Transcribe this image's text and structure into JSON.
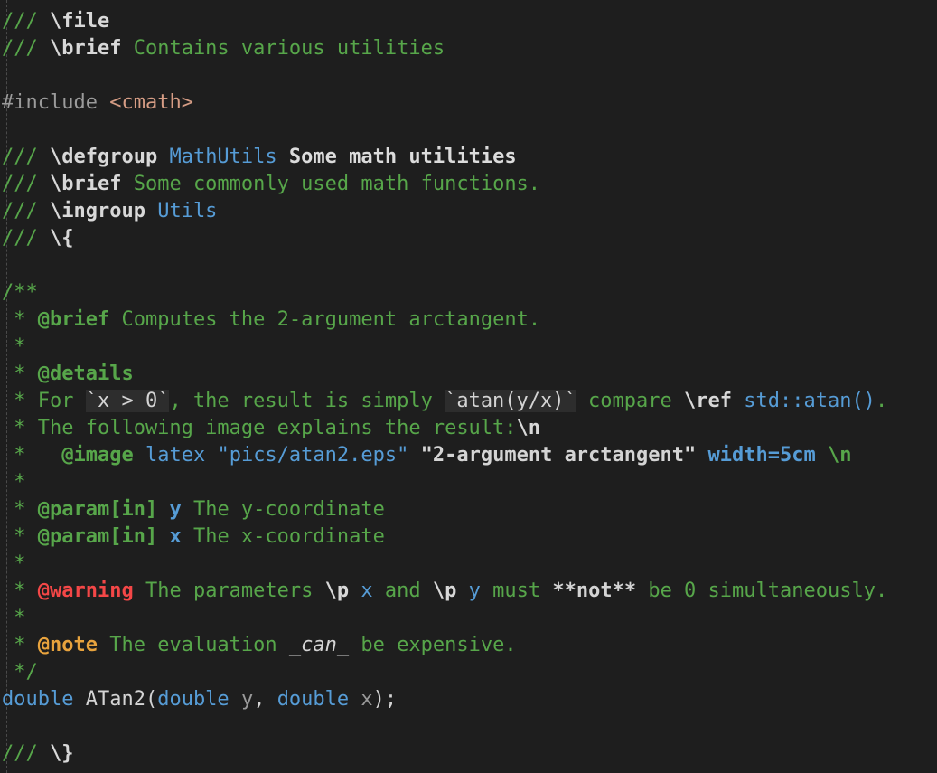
{
  "lines": [
    [
      {
        "t": "/// ",
        "c": "comment"
      },
      {
        "t": "\\file",
        "c": "tag-white"
      }
    ],
    [
      {
        "t": "/// ",
        "c": "comment"
      },
      {
        "t": "\\brief",
        "c": "tag-white"
      },
      {
        "t": " Contains various utilities",
        "c": "comment"
      }
    ],
    [],
    [
      {
        "t": "#include ",
        "c": "include"
      },
      {
        "t": "<cmath>",
        "c": "header"
      }
    ],
    [],
    [
      {
        "t": "/// ",
        "c": "comment"
      },
      {
        "t": "\\defgroup",
        "c": "tag-white"
      },
      {
        "t": " ",
        "c": "comment"
      },
      {
        "t": "MathUtils",
        "c": "name"
      },
      {
        "t": " Some math utilities",
        "c": "title"
      }
    ],
    [
      {
        "t": "/// ",
        "c": "comment"
      },
      {
        "t": "\\brief",
        "c": "tag-white"
      },
      {
        "t": " Some commonly used math functions.",
        "c": "comment"
      }
    ],
    [
      {
        "t": "/// ",
        "c": "comment"
      },
      {
        "t": "\\ingroup",
        "c": "tag-white"
      },
      {
        "t": " ",
        "c": "comment"
      },
      {
        "t": "Utils",
        "c": "name"
      }
    ],
    [
      {
        "t": "/// ",
        "c": "comment"
      },
      {
        "t": "\\{",
        "c": "tag-white"
      }
    ],
    [],
    [
      {
        "t": "/**",
        "c": "comment"
      }
    ],
    [
      {
        "t": " * ",
        "c": "comment"
      },
      {
        "t": "@brief",
        "c": "tag"
      },
      {
        "t": " Computes the 2-argument arctangent.",
        "c": "comment"
      }
    ],
    [
      {
        "t": " *",
        "c": "comment"
      }
    ],
    [
      {
        "t": " * ",
        "c": "comment"
      },
      {
        "t": "@details",
        "c": "tag"
      }
    ],
    [
      {
        "t": " * For ",
        "c": "comment"
      },
      {
        "t": "`x > 0`",
        "c": "code"
      },
      {
        "t": ", the result is simply ",
        "c": "comment"
      },
      {
        "t": "`atan(y/x)`",
        "c": "code"
      },
      {
        "t": " compare ",
        "c": "comment"
      },
      {
        "t": "\\ref",
        "c": "tag-white"
      },
      {
        "t": " ",
        "c": "comment"
      },
      {
        "t": "std::atan()",
        "c": "name"
      },
      {
        "t": ".",
        "c": "comment"
      }
    ],
    [
      {
        "t": " * The following image explains the result:",
        "c": "comment"
      },
      {
        "t": "\\n",
        "c": "tag-white"
      }
    ],
    [
      {
        "t": " *   ",
        "c": "comment"
      },
      {
        "t": "@image",
        "c": "tag"
      },
      {
        "t": " ",
        "c": "comment"
      },
      {
        "t": "latex",
        "c": "name"
      },
      {
        "t": " ",
        "c": "comment"
      },
      {
        "t": "\"pics/atan2.eps\"",
        "c": "name"
      },
      {
        "t": " ",
        "c": "comment"
      },
      {
        "t": "\"2-argument arctangent\"",
        "c": "quoted"
      },
      {
        "t": " ",
        "c": "comment"
      },
      {
        "t": "width=5cm",
        "c": "name-bold"
      },
      {
        "t": " ",
        "c": "comment"
      },
      {
        "t": "\\n",
        "c": "tag"
      }
    ],
    [
      {
        "t": " *",
        "c": "comment"
      }
    ],
    [
      {
        "t": " * ",
        "c": "comment"
      },
      {
        "t": "@param[in]",
        "c": "tag"
      },
      {
        "t": " ",
        "c": "comment"
      },
      {
        "t": "y",
        "c": "name-bold"
      },
      {
        "t": " The y-coordinate",
        "c": "comment"
      }
    ],
    [
      {
        "t": " * ",
        "c": "comment"
      },
      {
        "t": "@param[in]",
        "c": "tag"
      },
      {
        "t": " ",
        "c": "comment"
      },
      {
        "t": "x",
        "c": "name-bold"
      },
      {
        "t": " The x-coordinate",
        "c": "comment"
      }
    ],
    [
      {
        "t": " *",
        "c": "comment"
      }
    ],
    [
      {
        "t": " * ",
        "c": "comment"
      },
      {
        "t": "@warning",
        "c": "warning"
      },
      {
        "t": " The parameters ",
        "c": "comment"
      },
      {
        "t": "\\p",
        "c": "tag-white"
      },
      {
        "t": " ",
        "c": "comment"
      },
      {
        "t": "x",
        "c": "name"
      },
      {
        "t": " and ",
        "c": "comment"
      },
      {
        "t": "\\p",
        "c": "tag-white"
      },
      {
        "t": " ",
        "c": "comment"
      },
      {
        "t": "y",
        "c": "name"
      },
      {
        "t": " must ",
        "c": "comment"
      },
      {
        "t": "**not**",
        "c": "emph"
      },
      {
        "t": " be 0 simultaneously.",
        "c": "comment"
      }
    ],
    [
      {
        "t": " *",
        "c": "comment"
      }
    ],
    [
      {
        "t": " * ",
        "c": "comment"
      },
      {
        "t": "@note",
        "c": "note"
      },
      {
        "t": " The evaluation ",
        "c": "comment"
      },
      {
        "t": "_can_",
        "c": "italic"
      },
      {
        "t": " be expensive.",
        "c": "comment"
      }
    ],
    [
      {
        "t": " */",
        "c": "comment"
      }
    ],
    [
      {
        "t": "double",
        "c": "keyword"
      },
      {
        "t": " ATan2(",
        "c": "func"
      },
      {
        "t": "double",
        "c": "keyword"
      },
      {
        "t": " ",
        "c": "plain"
      },
      {
        "t": "y",
        "c": "param"
      },
      {
        "t": ", ",
        "c": "plain"
      },
      {
        "t": "double",
        "c": "keyword"
      },
      {
        "t": " ",
        "c": "plain"
      },
      {
        "t": "x",
        "c": "param"
      },
      {
        "t": ");",
        "c": "plain"
      }
    ],
    [],
    [
      {
        "t": "/// ",
        "c": "comment"
      },
      {
        "t": "\\}",
        "c": "tag-white"
      }
    ]
  ]
}
